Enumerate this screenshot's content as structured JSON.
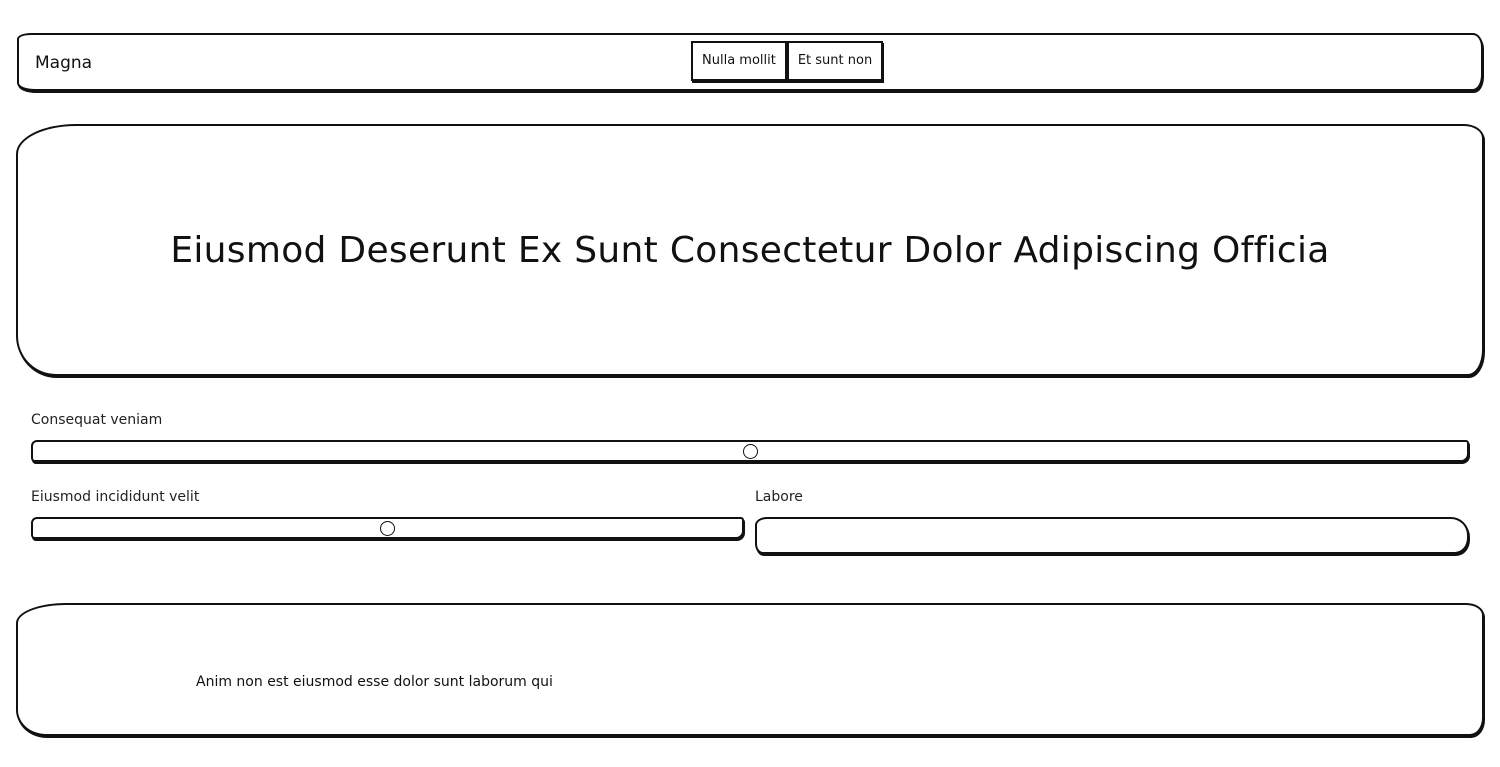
{
  "header": {
    "brand": "Magna",
    "nav": [
      {
        "label": "Nulla mollit"
      },
      {
        "label": "Et sunt non"
      }
    ]
  },
  "hero": {
    "title": "Eiusmod Deserunt Ex Sunt Consectetur Dolor Adipiscing Officia"
  },
  "form": {
    "slider1": {
      "label": "Consequat veniam",
      "value_fraction": 0.5
    },
    "slider2": {
      "label": "Eiusmod incididunt velit",
      "value_fraction": 0.5
    },
    "text_field": {
      "label": "Labore",
      "value": ""
    }
  },
  "footer": {
    "text": "Anim non est eiusmod esse dolor sunt laborum qui"
  }
}
